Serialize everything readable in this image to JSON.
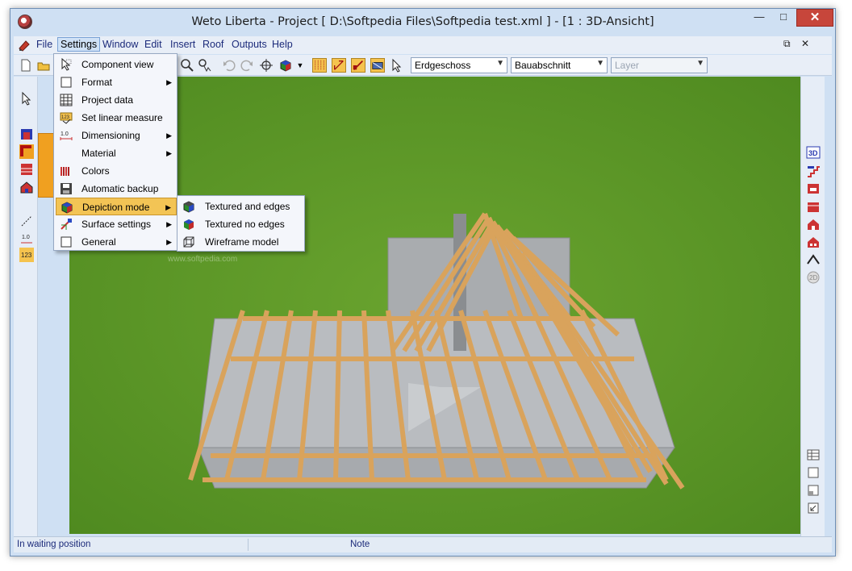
{
  "window": {
    "title": "Weto Liberta - Project [ D:\\Softpedia Files\\Softpedia test.xml ]  - [1 : 3D-Ansicht]",
    "minimize": "—",
    "maximize": "□",
    "close": "✕"
  },
  "menubar": {
    "items": [
      "File",
      "Settings",
      "Window",
      "Edit",
      "Insert",
      "Roof",
      "Outputs",
      "Help"
    ],
    "mdi_restore": "⧉",
    "mdi_close": "✕"
  },
  "toolbar": {
    "floor_combo": "Erdgeschoss",
    "section_combo": "Bauabschnitt",
    "layer_combo": "Layer"
  },
  "settings_menu": {
    "items": [
      {
        "label": "Component view",
        "icon": "cursor-icon",
        "submenu": false
      },
      {
        "label": "Format",
        "icon": "square-icon",
        "submenu": true
      },
      {
        "label": "Project data",
        "icon": "grid-icon",
        "submenu": false
      },
      {
        "label": "Set linear measure",
        "icon": "measure-icon",
        "submenu": false
      },
      {
        "label": "Dimensioning",
        "icon": "dimension-icon",
        "submenu": true
      },
      {
        "label": "Material",
        "icon": "blank-icon",
        "submenu": true
      },
      {
        "label": "Colors",
        "icon": "colors-icon",
        "submenu": false
      },
      {
        "label": "Automatic backup",
        "icon": "save-icon",
        "submenu": false
      },
      {
        "label": "Depiction mode",
        "icon": "cube-icon",
        "submenu": true
      },
      {
        "label": "Surface settings",
        "icon": "brush-icon",
        "submenu": true
      },
      {
        "label": "General",
        "icon": "square-icon",
        "submenu": true
      }
    ]
  },
  "depiction_submenu": {
    "items": [
      {
        "label": "Textured and edges",
        "icon": "cube-textured-icon"
      },
      {
        "label": "Textured no edges",
        "icon": "cube-colored-icon"
      },
      {
        "label": "Wireframe model",
        "icon": "wireframe-icon"
      }
    ]
  },
  "statusbar": {
    "left": "In waiting position",
    "note": "Note"
  },
  "watermark": "www.softpedia.com"
}
